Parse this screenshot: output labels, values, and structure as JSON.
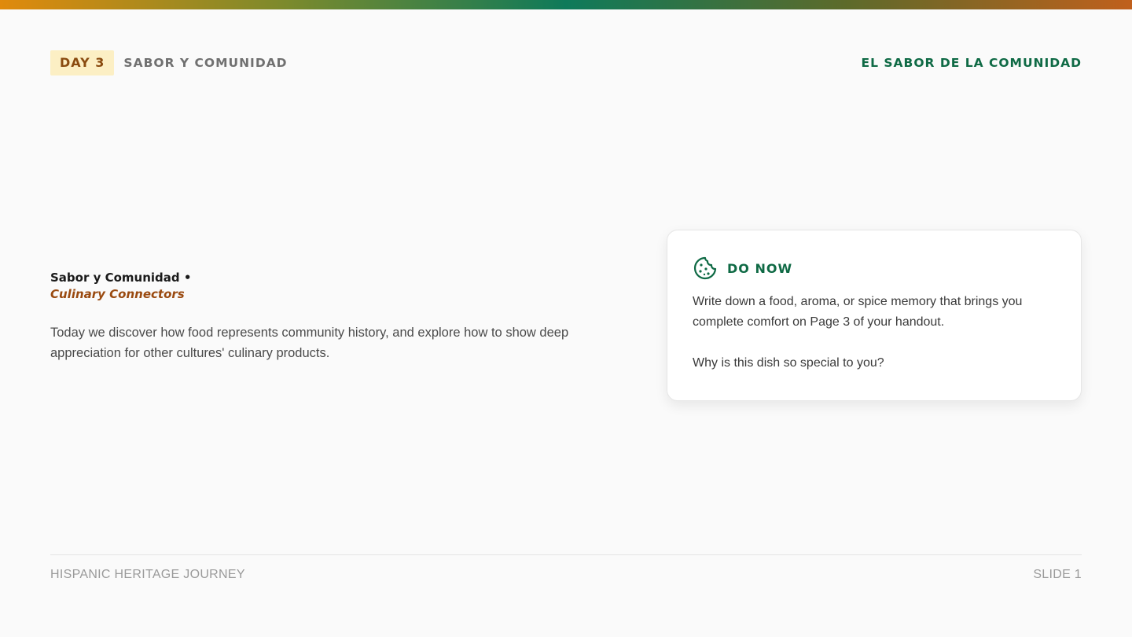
{
  "colors": {
    "accent_green": "#0f6a45",
    "accent_orange": "#9a4a10",
    "badge_bg": "#fcefc4",
    "gradient": [
      "#e08a0c",
      "#0e7a5a",
      "#c0601c"
    ]
  },
  "header": {
    "day_badge": "DAY 3",
    "section": "SABOR Y COMUNIDAD",
    "brand": "EL SABOR DE LA COMUNIDAD"
  },
  "main": {
    "title": "Sabor y Comunidad •",
    "subtitle": "Culinary Connectors",
    "lede": "Today we discover how food represents community history, and explore how to show deep appreciation for other cultures' culinary products."
  },
  "card": {
    "icon": "cookie-icon",
    "title": "DO NOW",
    "body": "Write down a food, aroma, or spice memory that brings you complete comfort on Page 3 of your handout.",
    "question": "Why is this dish so special to you?"
  },
  "footer": {
    "left": "HISPANIC HERITAGE JOURNEY",
    "right": "SLIDE 1"
  }
}
